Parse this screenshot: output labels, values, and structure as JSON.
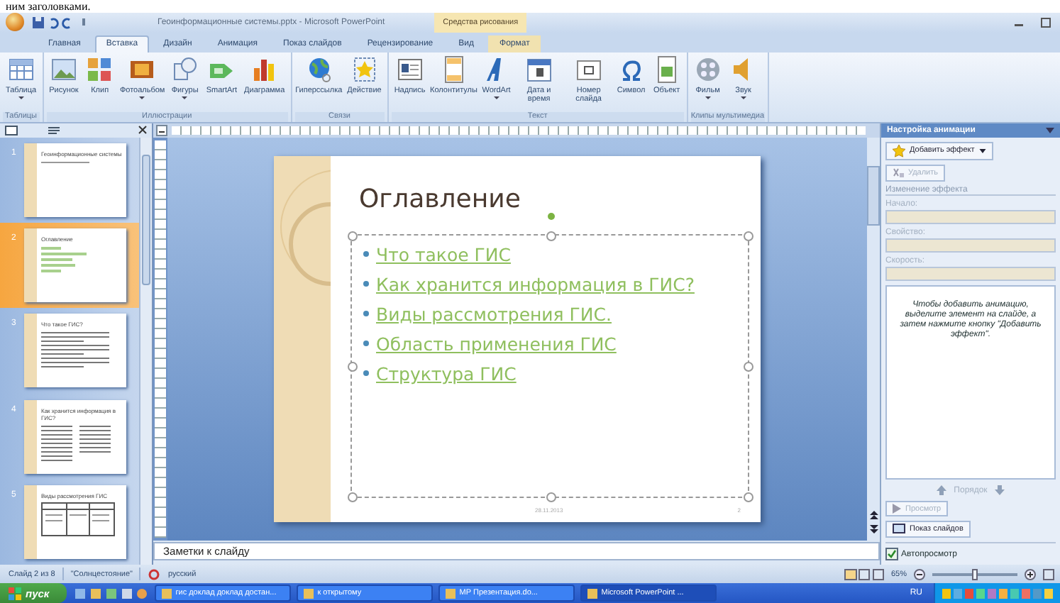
{
  "document_text": "ним заголовками.",
  "window": {
    "title": "Геоинформационные системы.pptx - Microsoft PowerPoint",
    "context_label": "Средства рисования"
  },
  "tabs": [
    {
      "label": "Главная",
      "selected": false,
      "contextual": false
    },
    {
      "label": "Вставка",
      "selected": true,
      "contextual": false
    },
    {
      "label": "Дизайн",
      "selected": false,
      "contextual": false
    },
    {
      "label": "Анимация",
      "selected": false,
      "contextual": false
    },
    {
      "label": "Показ слайдов",
      "selected": false,
      "contextual": false
    },
    {
      "label": "Рецензирование",
      "selected": false,
      "contextual": false
    },
    {
      "label": "Вид",
      "selected": false,
      "contextual": false
    },
    {
      "label": "Формат",
      "selected": false,
      "contextual": true
    }
  ],
  "ribbon_groups": [
    {
      "label": "Таблицы",
      "buttons": [
        {
          "label": "Таблица",
          "kind": "table",
          "dropdown": true
        }
      ]
    },
    {
      "label": "Иллюстрации",
      "buttons": [
        {
          "label": "Рисунок",
          "kind": "picture",
          "dropdown": false
        },
        {
          "label": "Клип",
          "kind": "clip",
          "dropdown": false
        },
        {
          "label": "Фотоальбом",
          "kind": "album",
          "dropdown": true
        },
        {
          "label": "Фигуры",
          "kind": "shapes",
          "dropdown": true
        },
        {
          "label": "SmartArt",
          "kind": "smartart",
          "dropdown": false
        },
        {
          "label": "Диаграмма",
          "kind": "chart",
          "dropdown": false
        }
      ]
    },
    {
      "label": "Связи",
      "buttons": [
        {
          "label": "Гиперссылка",
          "kind": "globe",
          "dropdown": false
        },
        {
          "label": "Действие",
          "kind": "star",
          "dropdown": false
        }
      ]
    },
    {
      "label": "Текст",
      "buttons": [
        {
          "label": "Надпись",
          "kind": "textbox",
          "dropdown": false
        },
        {
          "label": "Колонтитулы",
          "kind": "page",
          "dropdown": false
        },
        {
          "label": "WordArt",
          "kind": "wordart",
          "dropdown": true
        },
        {
          "label": "Дата и время",
          "kind": "calendar",
          "dropdown": false
        },
        {
          "label": "Номер слайда",
          "kind": "number",
          "dropdown": false
        },
        {
          "label": "Символ",
          "kind": "symbol",
          "dropdown": false
        },
        {
          "label": "Объект",
          "kind": "object",
          "dropdown": false
        }
      ]
    },
    {
      "label": "Клипы мультимедиа",
      "buttons": [
        {
          "label": "Фильм",
          "kind": "film",
          "dropdown": true
        },
        {
          "label": "Звук",
          "kind": "speaker",
          "dropdown": true
        }
      ]
    }
  ],
  "slides": [
    {
      "number": "1",
      "title": "Геоинформационные системы",
      "kind": "title",
      "selected": false
    },
    {
      "number": "2",
      "title": "Оглавление",
      "kind": "links",
      "selected": true
    },
    {
      "number": "3",
      "title": "Что такое ГИС?",
      "kind": "text",
      "selected": false
    },
    {
      "number": "4",
      "title": "Как хранится информация в ГИС?",
      "kind": "columns",
      "selected": false
    },
    {
      "number": "5",
      "title": "Виды рассмотрения ГИС",
      "kind": "table",
      "selected": false
    }
  ],
  "slide": {
    "title": "Оглавление",
    "links": [
      "Что такое ГИС",
      "Как хранится информация в ГИС?",
      "Виды рассмотрения ГИС.",
      "Область применения ГИС",
      "Структура ГИС"
    ],
    "date": "28.11.2013",
    "number": "2"
  },
  "notes": {
    "placeholder": "Заметки к слайду"
  },
  "animation_pane": {
    "title": "Настройка анимации",
    "add_button": "Добавить эффект",
    "remove_button": {
      "label": "Удалить",
      "disabled": true
    },
    "section": "Изменение эффекта",
    "fields": [
      {
        "label": "Начало:",
        "disabled": true
      },
      {
        "label": "Свойство:",
        "disabled": true
      },
      {
        "label": "Скорость:",
        "disabled": true
      }
    ],
    "hint": "Чтобы добавить анимацию, выделите элемент на слайде, а затем нажмите кнопку \"Добавить эффект\".",
    "order_label": "Порядок",
    "preview_button": {
      "label": "Просмотр",
      "disabled": true
    },
    "slideshow_button": "Показ слайдов",
    "autopreview": {
      "label": "Автопросмотр",
      "checked": true
    }
  },
  "status_bar": {
    "slide": "Слайд 2 из 8",
    "theme": "\"Солнцестояние\"",
    "language": "русский",
    "zoom": "65%",
    "zoom_slider": {
      "level": 0.5
    }
  },
  "taskbar": {
    "start": "пуск",
    "tasks": [
      {
        "label": "гис доклад доклад достан...",
        "selected": false
      },
      {
        "label": "к открытому",
        "selected": false
      },
      {
        "label": "МР Презентация.do...",
        "selected": false
      },
      {
        "label": "Microsoft PowerPoint ...",
        "selected": true
      }
    ],
    "language": "RU"
  }
}
